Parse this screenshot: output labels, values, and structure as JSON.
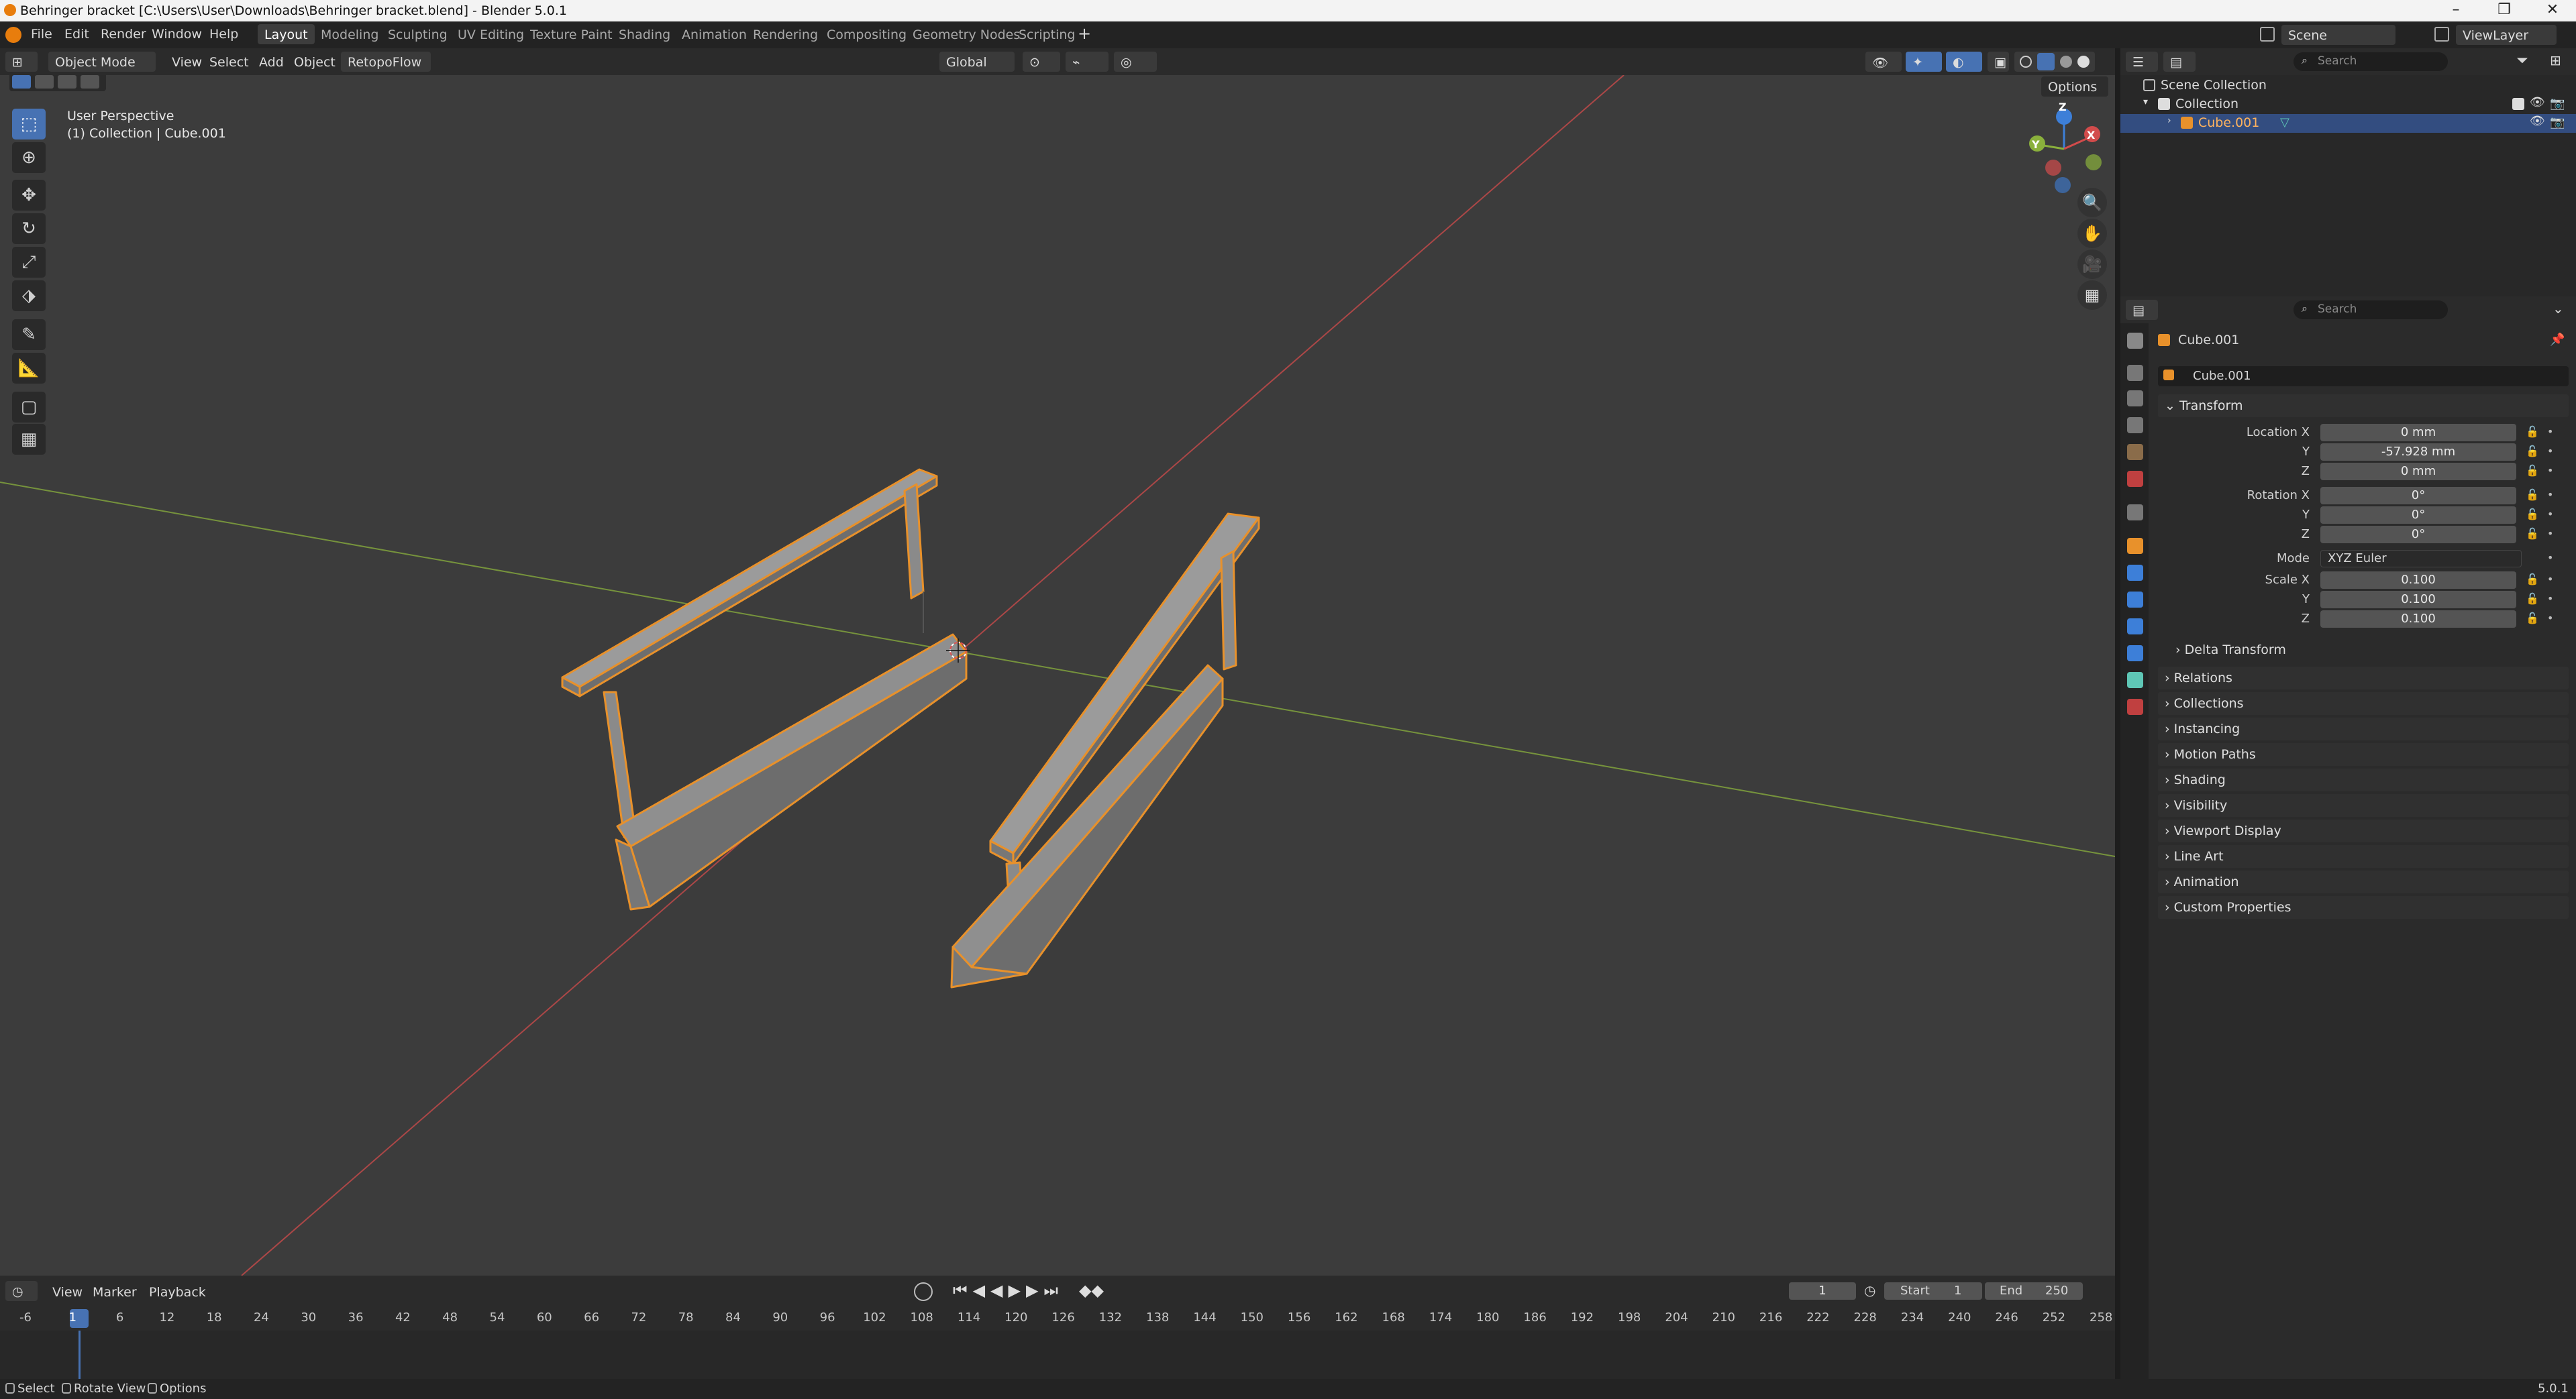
{
  "window": {
    "title": "Behringer bracket [C:\\Users\\User\\Downloads\\Behringer bracket.blend] - Blender 5.0.1",
    "controls": [
      "–",
      "❐",
      "✕"
    ]
  },
  "menu": {
    "items": [
      "File",
      "Edit",
      "Render",
      "Window",
      "Help"
    ],
    "workspaces": [
      "Layout",
      "Modeling",
      "Sculpting",
      "UV Editing",
      "Texture Paint",
      "Shading",
      "Animation",
      "Rendering",
      "Compositing",
      "Geometry Nodes",
      "Scripting"
    ],
    "add_tab": "+",
    "scene": "Scene",
    "view_layer": "ViewLayer"
  },
  "viewport_header": {
    "mode": "Object Mode",
    "menus": [
      "View",
      "Select",
      "Add",
      "Object",
      "RetopoFlow"
    ],
    "orientation": "Global",
    "options": "Options"
  },
  "viewport": {
    "perspective": "User Perspective",
    "collection_info": "(1) Collection | Cube.001",
    "gizmo_labels": [
      "Z",
      "Y",
      "X"
    ]
  },
  "timeline": {
    "menus": [
      "View",
      "Marker",
      "Playback"
    ],
    "current_frame": "1",
    "start_label": "Start",
    "start": "1",
    "end_label": "End",
    "end": "250",
    "ticks": [
      "-6",
      "1",
      "6",
      "12",
      "18",
      "24",
      "30",
      "36",
      "42",
      "48",
      "54",
      "60",
      "66",
      "72",
      "78",
      "84",
      "90",
      "96",
      "102",
      "108",
      "114",
      "120",
      "126",
      "132",
      "138",
      "144",
      "150",
      "156",
      "162",
      "168",
      "174",
      "180",
      "186",
      "192",
      "198",
      "204",
      "210",
      "216",
      "222",
      "228",
      "234",
      "240",
      "246",
      "252",
      "258"
    ]
  },
  "status": {
    "items": [
      "Select",
      "Rotate View",
      "Options"
    ],
    "version": "5.0.1"
  },
  "outliner": {
    "search_placeholder": "Search",
    "rows": [
      {
        "label": "Scene Collection"
      },
      {
        "label": "Collection"
      },
      {
        "label": "Cube.001"
      }
    ]
  },
  "properties": {
    "search_placeholder": "Search",
    "object_name": "Cube.001",
    "data_name": "Cube.001",
    "transform": {
      "title": "Transform",
      "location_label": "Location X",
      "location": [
        "0 mm",
        "-57.928 mm",
        "0 mm"
      ],
      "rotation_label": "Rotation X",
      "rotation": [
        "0°",
        "0°",
        "0°"
      ],
      "mode_label": "Mode",
      "mode": "XYZ Euler",
      "scale_label": "Scale X",
      "scale": [
        "0.100",
        "0.100",
        "0.100"
      ],
      "y": "Y",
      "z": "Z",
      "delta": "Delta Transform"
    },
    "panels": [
      "Relations",
      "Collections",
      "Instancing",
      "Motion Paths",
      "Shading",
      "Visibility",
      "Viewport Display",
      "Line Art",
      "Animation",
      "Custom Properties"
    ]
  },
  "colors": {
    "accent": "#4772b3",
    "selection_outline": "#e8912b",
    "x_axis": "#d24b4b",
    "y_axis": "#8ab03c",
    "z_axis": "#3d7fd8"
  }
}
